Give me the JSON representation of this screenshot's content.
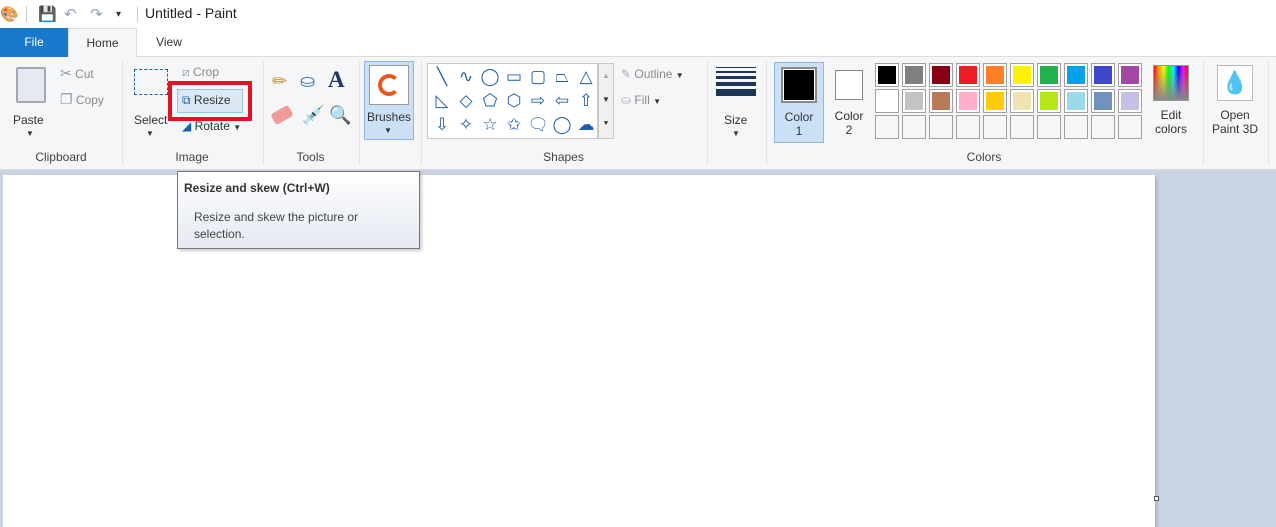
{
  "window": {
    "title": "Untitled - Paint"
  },
  "tabs": [
    {
      "label": "File"
    },
    {
      "label": "Home"
    },
    {
      "label": "View"
    }
  ],
  "clipboard": {
    "paste": "Paste",
    "cut": "Cut",
    "copy": "Copy",
    "group": "Clipboard"
  },
  "image": {
    "select": "Select",
    "crop": "Crop",
    "resize": "Resize",
    "rotate": "Rotate",
    "group": "Image"
  },
  "tools": {
    "group": "Tools"
  },
  "brushes": {
    "label": "Brushes"
  },
  "shapes": {
    "outline": "Outline",
    "fill": "Fill",
    "group": "Shapes",
    "items": [
      "╲",
      "∿",
      "◯",
      "▭",
      "▢",
      "⏢",
      "△",
      "◺",
      "◇",
      "⬠",
      "⬡",
      "⇨",
      "⇦",
      "⇧",
      "⇩",
      "✧",
      "☆",
      "✩",
      "🗨",
      "◯",
      "☁"
    ]
  },
  "size": {
    "label": "Size"
  },
  "colors": {
    "color1_a": "Color",
    "color1_b": "1",
    "color2_a": "Color",
    "color2_b": "2",
    "edit_a": "Edit",
    "edit_b": "colors",
    "group": "Colors",
    "color1_value": "#000000",
    "color2_value": "#ffffff",
    "palette": [
      "#000000",
      "#7f7f7f",
      "#880015",
      "#ed1c24",
      "#ff7f27",
      "#fff200",
      "#22b14c",
      "#00a2e8",
      "#3f48cc",
      "#a349a4",
      "#ffffff",
      "#c3c3c3",
      "#b97a57",
      "#ffaec9",
      "#ffc90e",
      "#efe4b0",
      "#b5e61d",
      "#99d9ea",
      "#7092be",
      "#c8bfe7",
      "",
      "",
      "",
      "",
      "",
      "",
      "",
      "",
      "",
      ""
    ]
  },
  "paint3d": {
    "a": "Open",
    "b": "Paint 3D"
  },
  "tooltip": {
    "title": "Resize and skew (Ctrl+W)",
    "body": "Resize and skew the picture or selection."
  },
  "highlight_color": "#e81123"
}
